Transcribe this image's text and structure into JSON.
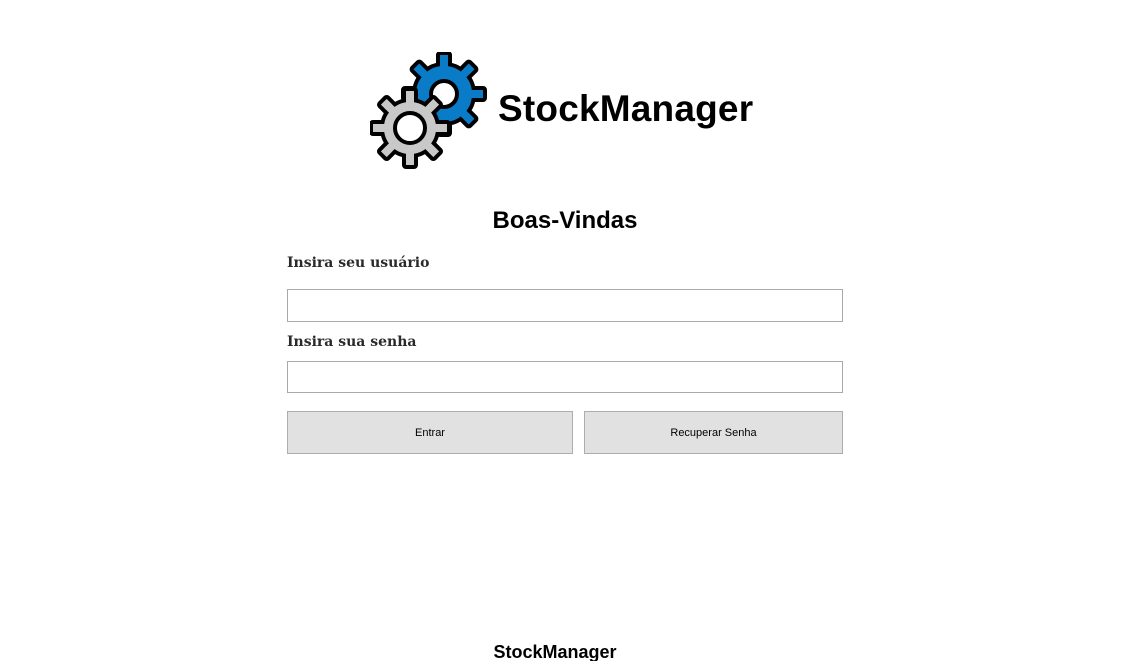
{
  "header": {
    "logo_icon": "gears-icon",
    "app_name": "StockManager"
  },
  "login": {
    "title": "Boas-Vindas",
    "username_label": "Insira seu usuário",
    "username_value": "",
    "password_label": "Insira sua senha",
    "password_value": "",
    "enter_button": "Entrar",
    "recover_button": "Recuperar Senha"
  },
  "footer": {
    "text": "StockManager"
  },
  "colors": {
    "gear_primary": "#0a7bc6",
    "gear_secondary": "#c8c8c8",
    "button_bg": "#e1e1e1",
    "field_border": "#a9a9a9"
  }
}
